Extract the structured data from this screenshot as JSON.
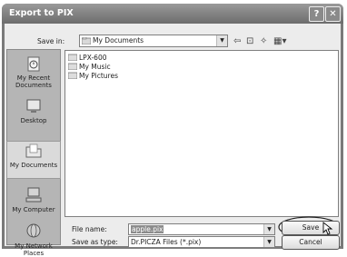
{
  "window": {
    "title": "Export to PIX",
    "help_label": "?",
    "close_label": "✕"
  },
  "savein": {
    "label": "Save in:",
    "value": "My Documents"
  },
  "places": [
    {
      "label": "My Recent Documents",
      "icon": "recent-documents-icon"
    },
    {
      "label": "Desktop",
      "icon": "desktop-icon"
    },
    {
      "label": "My Documents",
      "icon": "my-documents-icon"
    },
    {
      "label": "My Computer",
      "icon": "my-computer-icon"
    },
    {
      "label": "My Network Places",
      "icon": "network-places-icon"
    }
  ],
  "files": [
    {
      "name": "LPX-600",
      "icon": "folder-icon"
    },
    {
      "name": "My Music",
      "icon": "folder-icon"
    },
    {
      "name": "My Pictures",
      "icon": "folder-icon"
    }
  ],
  "filename": {
    "label": "File name:",
    "value": "apple.pix"
  },
  "savetype": {
    "label": "Save as type:",
    "value": "Dr.PICZA Files (*.pix)"
  },
  "buttons": {
    "save": "Save",
    "cancel": "Cancel"
  }
}
